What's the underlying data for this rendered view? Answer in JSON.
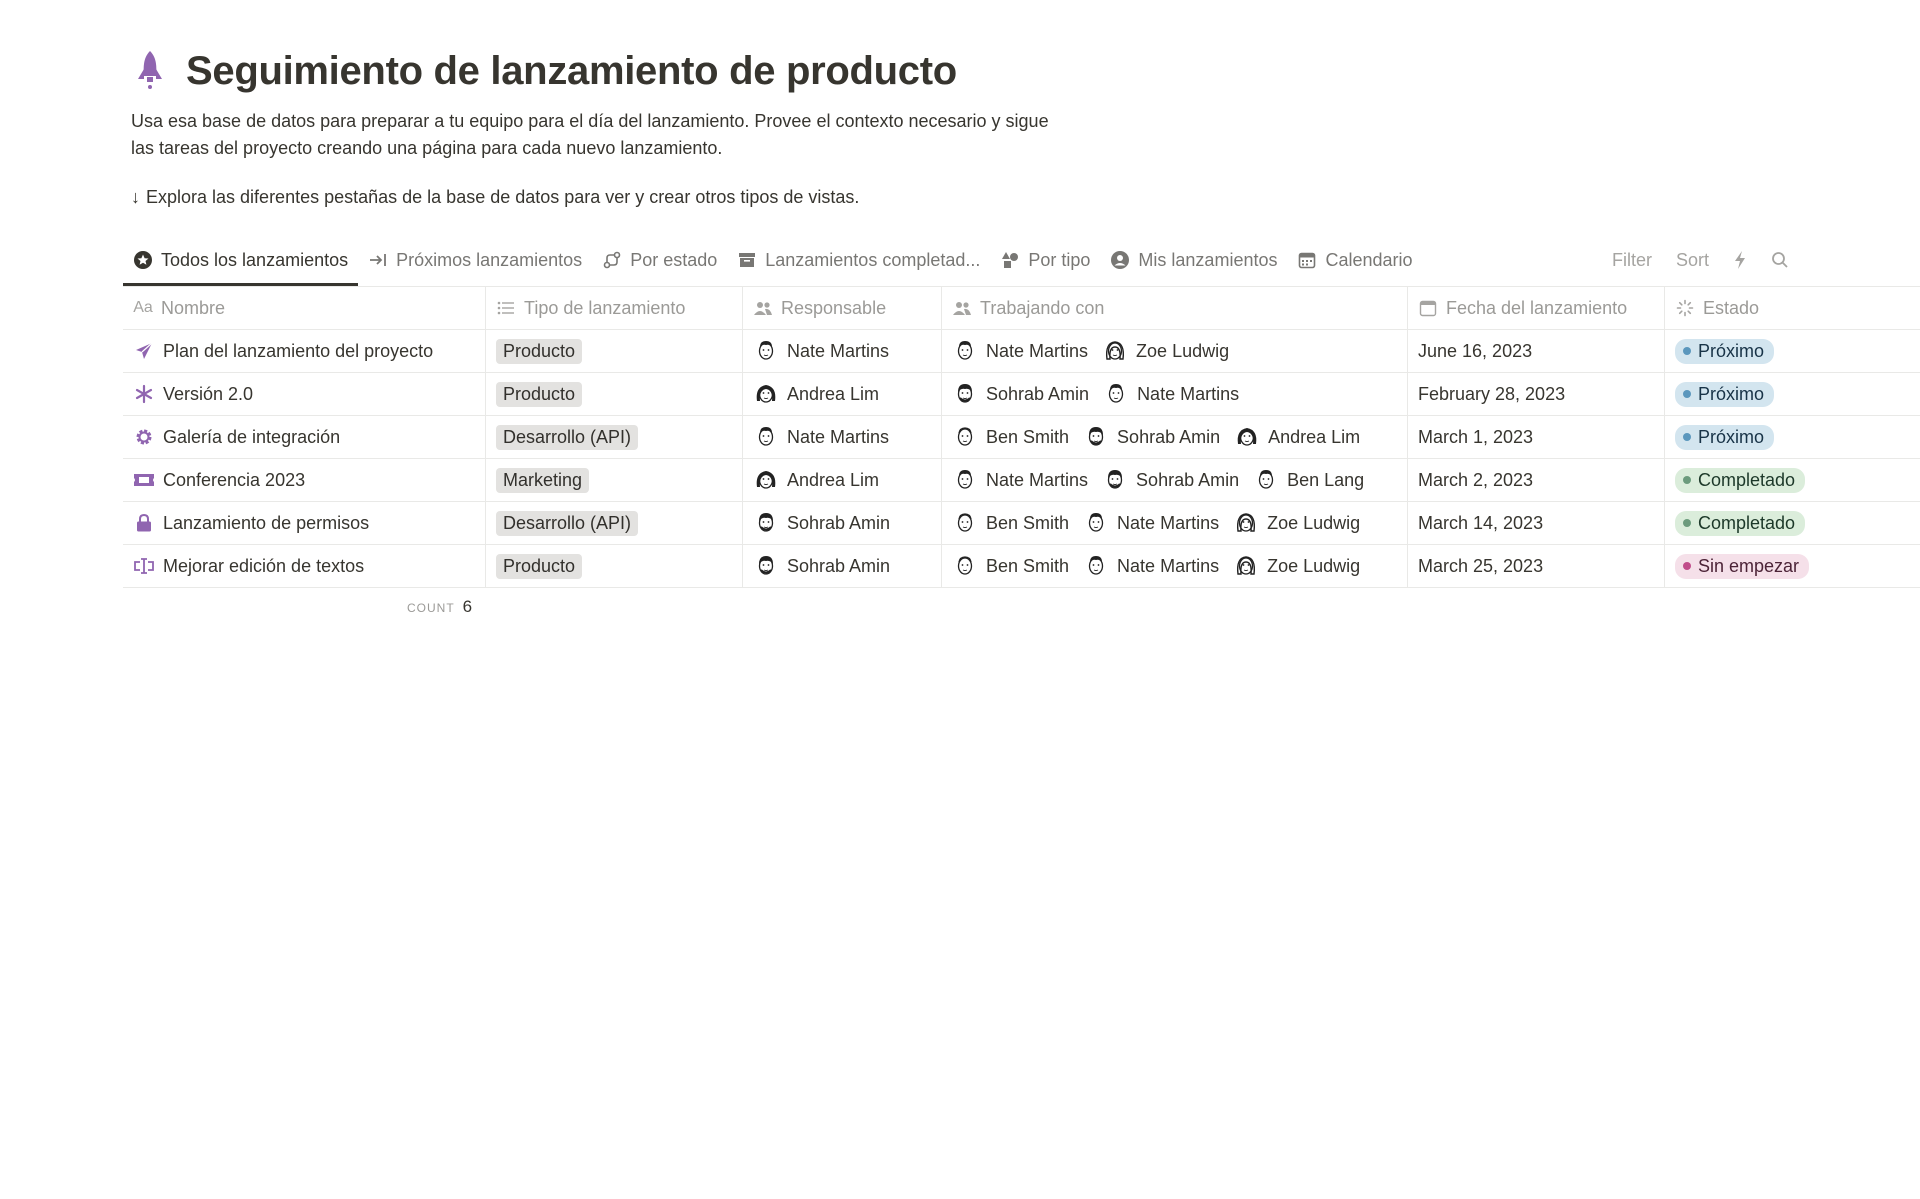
{
  "page": {
    "icon": "rocket-icon",
    "title": "Seguimiento de lanzamiento de producto",
    "description_line1": "Usa esa base de datos para preparar a tu equipo para el día del lanzamiento. Provee el contexto necesario y sigue",
    "description_line2": "las tareas del proyecto creando una página para cada nuevo lanzamiento.",
    "hint": "Explora las diferentes pestañas de la base de datos para ver y crear otros tipos de vistas.",
    "accent_color": "#9065b0"
  },
  "tabs": [
    {
      "label": "Todos los lanzamientos",
      "icon": "star-circle-icon",
      "active": true
    },
    {
      "label": "Próximos lanzamientos",
      "icon": "arrow-to-right-icon",
      "active": false
    },
    {
      "label": "Por estado",
      "icon": "route-icon",
      "active": false
    },
    {
      "label": "Lanzamientos completad...",
      "icon": "archive-icon",
      "active": false
    },
    {
      "label": "Por tipo",
      "icon": "shapes-icon",
      "active": false
    },
    {
      "label": "Mis lanzamientos",
      "icon": "user-circle-icon",
      "active": false
    },
    {
      "label": "Calendario",
      "icon": "calendar-icon",
      "active": false
    }
  ],
  "toolbar": {
    "filter": "Filter",
    "sort": "Sort"
  },
  "columns": [
    {
      "label": "Nombre",
      "icon": "Aa"
    },
    {
      "label": "Tipo de lanzamiento",
      "icon": "list-icon"
    },
    {
      "label": "Responsable",
      "icon": "people-icon"
    },
    {
      "label": "Trabajando con",
      "icon": "people-icon"
    },
    {
      "label": "Fecha del lanzamiento",
      "icon": "calendar-icon"
    },
    {
      "label": "Estado",
      "icon": "status-icon"
    }
  ],
  "rows": [
    {
      "name": "Plan del lanzamiento del proyecto",
      "icon": "paper-plane-icon",
      "type": "Producto",
      "owner": "Nate Martins",
      "with": [
        "Nate Martins",
        "Zoe Ludwig"
      ],
      "date": "June 16, 2023",
      "status": "Próximo",
      "status_kind": "upcoming"
    },
    {
      "name": "Versión 2.0",
      "icon": "asterisk-icon",
      "type": "Producto",
      "owner": "Andrea Lim",
      "with": [
        "Sohrab Amin",
        "Nate Martins"
      ],
      "date": "February 28, 2023",
      "status": "Próximo",
      "status_kind": "upcoming"
    },
    {
      "name": "Galería de integración",
      "icon": "gear-icon",
      "type": "Desarrollo (API)",
      "owner": "Nate Martins",
      "with": [
        "Ben Smith",
        "Sohrab Amin",
        "Andrea Lim"
      ],
      "date": "March 1, 2023",
      "status": "Próximo",
      "status_kind": "upcoming"
    },
    {
      "name": "Conferencia 2023",
      "icon": "ticket-icon",
      "type": "Marketing",
      "owner": "Andrea Lim",
      "with": [
        "Nate Martins",
        "Sohrab Amin",
        "Ben Lang"
      ],
      "date": "March 2, 2023",
      "status": "Completado",
      "status_kind": "done"
    },
    {
      "name": "Lanzamiento de permisos",
      "icon": "lock-icon",
      "type": "Desarrollo (API)",
      "owner": "Sohrab Amin",
      "with": [
        "Ben Smith",
        "Nate Martins",
        "Zoe Ludwig"
      ],
      "date": "March 14, 2023",
      "status": "Completado",
      "status_kind": "done"
    },
    {
      "name": "Mejorar edición de textos",
      "icon": "text-cursor-icon",
      "type": "Producto",
      "owner": "Sohrab Amin",
      "with": [
        "Ben Smith",
        "Nate Martins",
        "Zoe Ludwig"
      ],
      "date": "March 25, 2023",
      "status": "Sin empezar",
      "status_kind": "todo"
    }
  ],
  "status_colors": {
    "upcoming": {
      "bg": "#d3e5ef",
      "dot": "#5b97bd",
      "text": "#183347"
    },
    "done": {
      "bg": "#dbeddb",
      "dot": "#6c9b7d",
      "text": "#1c3829"
    },
    "todo": {
      "bg": "#f5e0e9",
      "dot": "#c14c8a",
      "text": "#4c2337"
    }
  },
  "footer": {
    "count_label": "COUNT",
    "count_value": "6"
  }
}
